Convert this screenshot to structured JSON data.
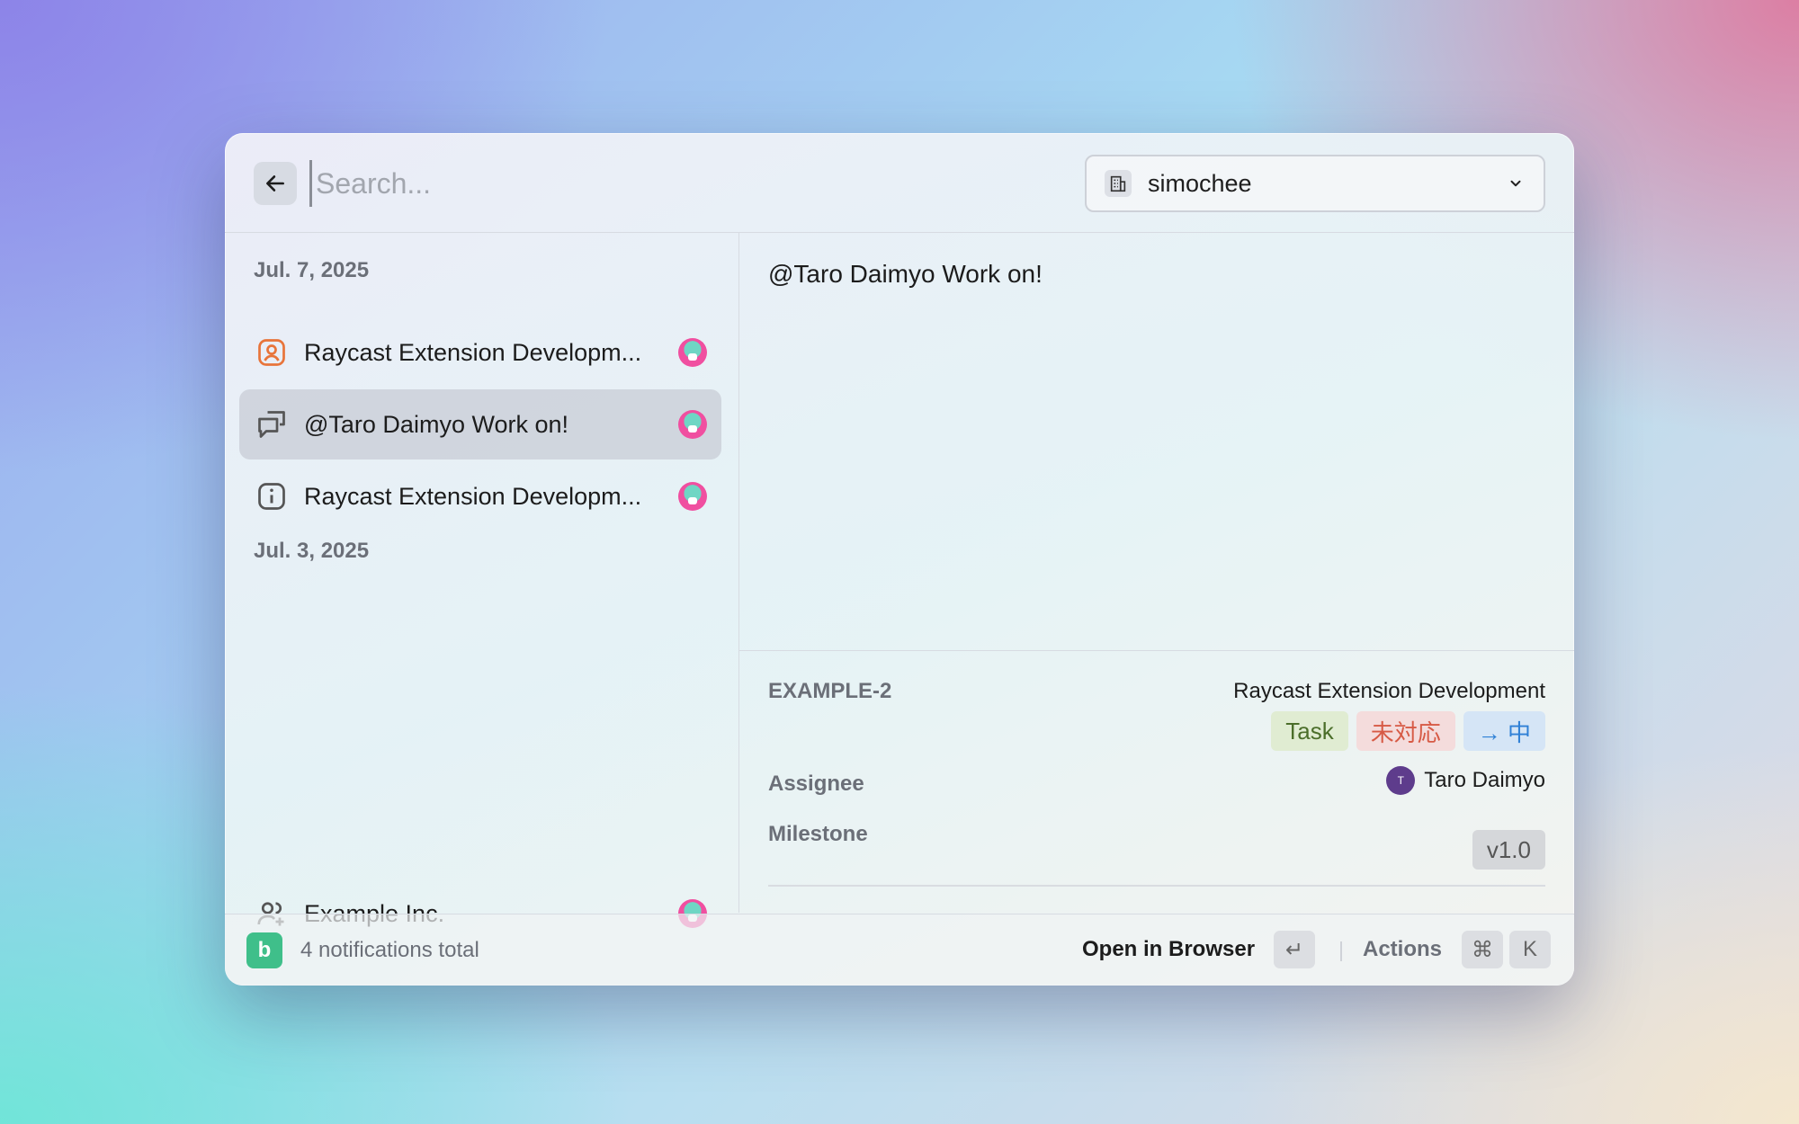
{
  "search": {
    "placeholder": "Search..."
  },
  "org_selector": {
    "value": "simochee"
  },
  "notifications": {
    "groups": [
      {
        "date": "Jul. 7, 2025",
        "items": [
          {
            "title": "Raycast Extension Developm...",
            "icon": "person-badge-icon"
          },
          {
            "title": "@Taro Daimyo Work on!",
            "icon": "comment-icon",
            "selected": true
          },
          {
            "title": "Raycast Extension Developm...",
            "icon": "info-icon"
          }
        ]
      },
      {
        "date": "Jul. 3, 2025",
        "items": [
          {
            "title": "Example Inc.",
            "icon": "user-add-icon"
          }
        ]
      }
    ]
  },
  "detail": {
    "content": "@Taro Daimyo Work on!",
    "issue_key": "EXAMPLE-2",
    "project": "Raycast Extension Development",
    "tags": {
      "type": "Task",
      "status": "未対応",
      "priority": "→ 中"
    },
    "assignee_label": "Assignee",
    "assignee_initial": "T",
    "assignee_name": "Taro Daimyo",
    "milestone_label": "Milestone",
    "milestone_value": "v1.0"
  },
  "footer": {
    "count_text": "4 notifications total",
    "primary_action": "Open in Browser",
    "enter_key": "↵",
    "actions_label": "Actions",
    "cmd_key": "⌘",
    "k_key": "K"
  },
  "colors": {
    "task_tag": "#e0ecd2",
    "status_tag": "#f4dcdc",
    "priority_tag": "#d5e5f6",
    "brand": "#3fbf8a",
    "accent_orange": "#e8743a"
  }
}
